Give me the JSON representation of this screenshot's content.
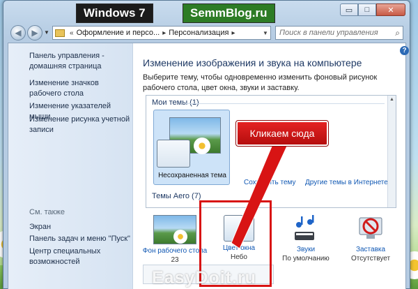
{
  "labels": {
    "os": "Windows 7",
    "blog": "SemmBlog.ru"
  },
  "window": {
    "controls": {
      "minimize": "▭",
      "maximize": "□",
      "close": "✕"
    }
  },
  "nav": {
    "breadcrumb": [
      "Оформление и персо...",
      "Персонализация"
    ],
    "search_placeholder": "Поиск в панели управления"
  },
  "sidebar": {
    "links": [
      "Панель управления - домашняя страница",
      "Изменение значков рабочего стола",
      "Изменение указателей мыши",
      "Изменение рисунка учетной записи"
    ],
    "see_also_heading": "См. также",
    "see_also": [
      "Экран",
      "Панель задач и меню \"Пуск\"",
      "Центр специальных возможностей"
    ]
  },
  "main": {
    "title": "Изменение изображения и звука на компьютере",
    "description": "Выберите тему, чтобы одновременно изменить фоновый рисунок рабочего стола, цвет окна, звуки и заставку.",
    "help": "?"
  },
  "themes": {
    "group_my": "Мои темы (1)",
    "card_label": "Несохраненная тема",
    "link_save": "Сохранить тему",
    "link_online": "Другие темы в Интернете",
    "group_aero": "Темы Aero (7)"
  },
  "bottom": [
    {
      "label": "Фон рабочего стола",
      "sub": "23"
    },
    {
      "label": "Цвет окна",
      "sub": "Небо"
    },
    {
      "label": "Звуки",
      "sub": "По умолчанию"
    },
    {
      "label": "Заставка",
      "sub": "Отсутствует"
    }
  ],
  "annotation": {
    "callout": "Кликаем сюда"
  },
  "watermark": "EasyDoit.ru",
  "colors": {
    "annotation_red": "#d81414",
    "link_blue": "#0f57b3",
    "title_blue": "#1e3964"
  }
}
